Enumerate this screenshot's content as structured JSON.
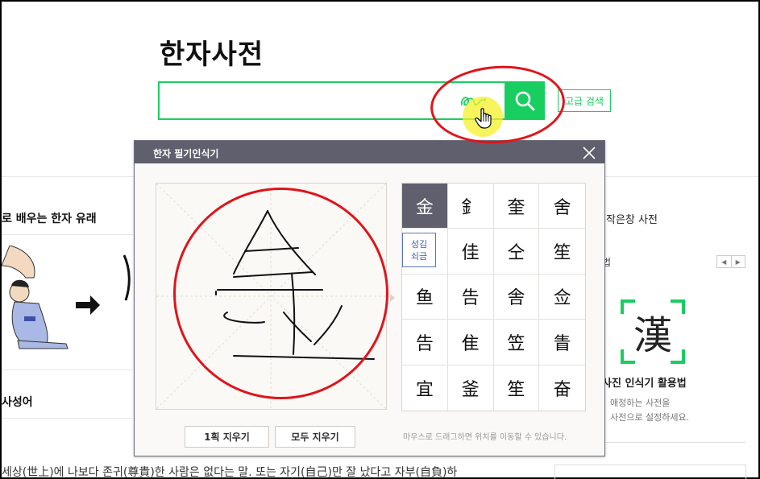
{
  "page": {
    "title": "한자사전"
  },
  "search": {
    "value": "",
    "pen_icon": "handwriting-pen-icon",
    "search_icon": "magnifier-icon",
    "advanced_label": "고급 검색"
  },
  "background": {
    "left_heading_1": "로 배우는 한자 유래",
    "left_heading_2": "사성어",
    "bottom_text": "세상(世上)에 나보다 존귀(尊貴)한 사람은 없다는 말. 또는 자기(自己)만 잘 났다고 자부(自負)하",
    "right_link": "작은창 사전",
    "right_fragment": "법",
    "pager_prev": "◀",
    "pager_next": "▶",
    "logo_char": "漢",
    "right_title": "사진 인식기 활용법",
    "right_desc_1": "애정하는 사전을",
    "right_desc_2": "사전으로 설정하세요."
  },
  "dialog": {
    "title": "한자 필기인식기",
    "candidates": [
      "金",
      "釒",
      "奎",
      "舍",
      "",
      "佳",
      "仝",
      "笙",
      "鱼",
      "告",
      "舎",
      "佥",
      "告",
      "隹",
      "笠",
      "眚",
      "宜",
      "釜",
      "笙",
      "奋"
    ],
    "selected_index": 0,
    "reading_tooltip": [
      "성김",
      "쇠금"
    ],
    "btn_one_stroke": "1획 지우기",
    "btn_clear_all": "모두 지우기",
    "drag_hint": "마우스로 드래그하면 위치를 이동할 수 있습니다."
  },
  "colors": {
    "accent_green": "#19ce60",
    "dialog_header": "#5f5f6d",
    "annotation_red": "#e0141b"
  }
}
